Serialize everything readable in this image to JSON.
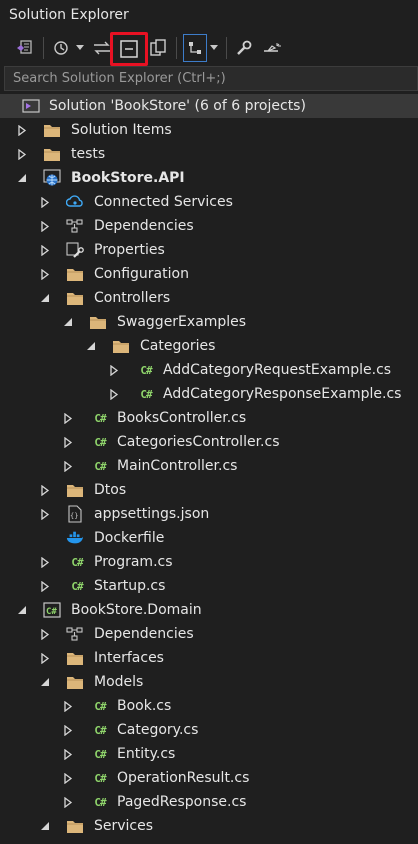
{
  "window": {
    "title": "Solution Explorer"
  },
  "search": {
    "placeholder": "Search Solution Explorer (Ctrl+;)"
  },
  "toolbar": {
    "items": [
      "vs-home-icon",
      "history-icon",
      "sync-icon",
      "collapse-all-icon",
      "show-all-files-icon",
      "preview-icon",
      "properties-wrench-icon",
      "pending-changes-icon"
    ]
  },
  "tree": [
    {
      "label": "Solution 'BookStore' (6 of 6 projects)",
      "icon": "solution-icon",
      "arrow": "none",
      "level": 0
    },
    {
      "label": "Solution Items",
      "icon": "folder-icon",
      "arrow": "collapsed",
      "level": 0
    },
    {
      "label": "tests",
      "icon": "folder-icon",
      "arrow": "collapsed",
      "level": 0
    },
    {
      "label": "BookStore.API",
      "icon": "web-project-icon",
      "arrow": "expanded",
      "level": 0,
      "bold": true
    },
    {
      "label": "Connected Services",
      "icon": "connected-services-icon",
      "arrow": "collapsed",
      "level": 1
    },
    {
      "label": "Dependencies",
      "icon": "dependencies-icon",
      "arrow": "collapsed",
      "level": 1
    },
    {
      "label": "Properties",
      "icon": "properties-icon",
      "arrow": "collapsed",
      "level": 1
    },
    {
      "label": "Configuration",
      "icon": "folder-icon",
      "arrow": "collapsed",
      "level": 1
    },
    {
      "label": "Controllers",
      "icon": "folder-icon",
      "arrow": "expanded",
      "level": 1
    },
    {
      "label": "SwaggerExamples",
      "icon": "folder-icon",
      "arrow": "expanded",
      "level": 2
    },
    {
      "label": "Categories",
      "icon": "folder-icon",
      "arrow": "expanded",
      "level": 3
    },
    {
      "label": "AddCategoryRequestExample.cs",
      "icon": "csharp-file-icon",
      "arrow": "collapsed",
      "level": 4
    },
    {
      "label": "AddCategoryResponseExample.cs",
      "icon": "csharp-file-icon",
      "arrow": "collapsed",
      "level": 4
    },
    {
      "label": "BooksController.cs",
      "icon": "csharp-file-icon",
      "arrow": "collapsed",
      "level": 2
    },
    {
      "label": "CategoriesController.cs",
      "icon": "csharp-file-icon",
      "arrow": "collapsed",
      "level": 2
    },
    {
      "label": "MainController.cs",
      "icon": "csharp-file-icon",
      "arrow": "collapsed",
      "level": 2
    },
    {
      "label": "Dtos",
      "icon": "folder-icon",
      "arrow": "collapsed",
      "level": 1
    },
    {
      "label": "appsettings.json",
      "icon": "json-file-icon",
      "arrow": "collapsed",
      "level": 1
    },
    {
      "label": "Dockerfile",
      "icon": "docker-icon",
      "arrow": "none",
      "level": 1
    },
    {
      "label": "Program.cs",
      "icon": "csharp-file-icon",
      "arrow": "collapsed",
      "level": 1
    },
    {
      "label": "Startup.cs",
      "icon": "csharp-file-icon",
      "arrow": "collapsed",
      "level": 1
    },
    {
      "label": "BookStore.Domain",
      "icon": "csharp-project-icon",
      "arrow": "expanded",
      "level": 0
    },
    {
      "label": "Dependencies",
      "icon": "dependencies-icon",
      "arrow": "collapsed",
      "level": 1
    },
    {
      "label": "Interfaces",
      "icon": "folder-icon",
      "arrow": "collapsed",
      "level": 1
    },
    {
      "label": "Models",
      "icon": "folder-icon",
      "arrow": "expanded",
      "level": 1
    },
    {
      "label": "Book.cs",
      "icon": "csharp-file-icon",
      "arrow": "collapsed",
      "level": 2
    },
    {
      "label": "Category.cs",
      "icon": "csharp-file-icon",
      "arrow": "collapsed",
      "level": 2
    },
    {
      "label": "Entity.cs",
      "icon": "csharp-file-icon",
      "arrow": "collapsed",
      "level": 2
    },
    {
      "label": "OperationResult.cs",
      "icon": "csharp-file-icon",
      "arrow": "collapsed",
      "level": 2
    },
    {
      "label": "PagedResponse.cs",
      "icon": "csharp-file-icon",
      "arrow": "collapsed",
      "level": 2
    },
    {
      "label": "Services",
      "icon": "folder-icon",
      "arrow": "expanded",
      "level": 1
    }
  ],
  "colors": {
    "background": "#1f1f1f",
    "selected_row": "#393939",
    "highlight_box": "#e81123",
    "folder": "#dcb67a",
    "csharp": "#8fd46b"
  }
}
